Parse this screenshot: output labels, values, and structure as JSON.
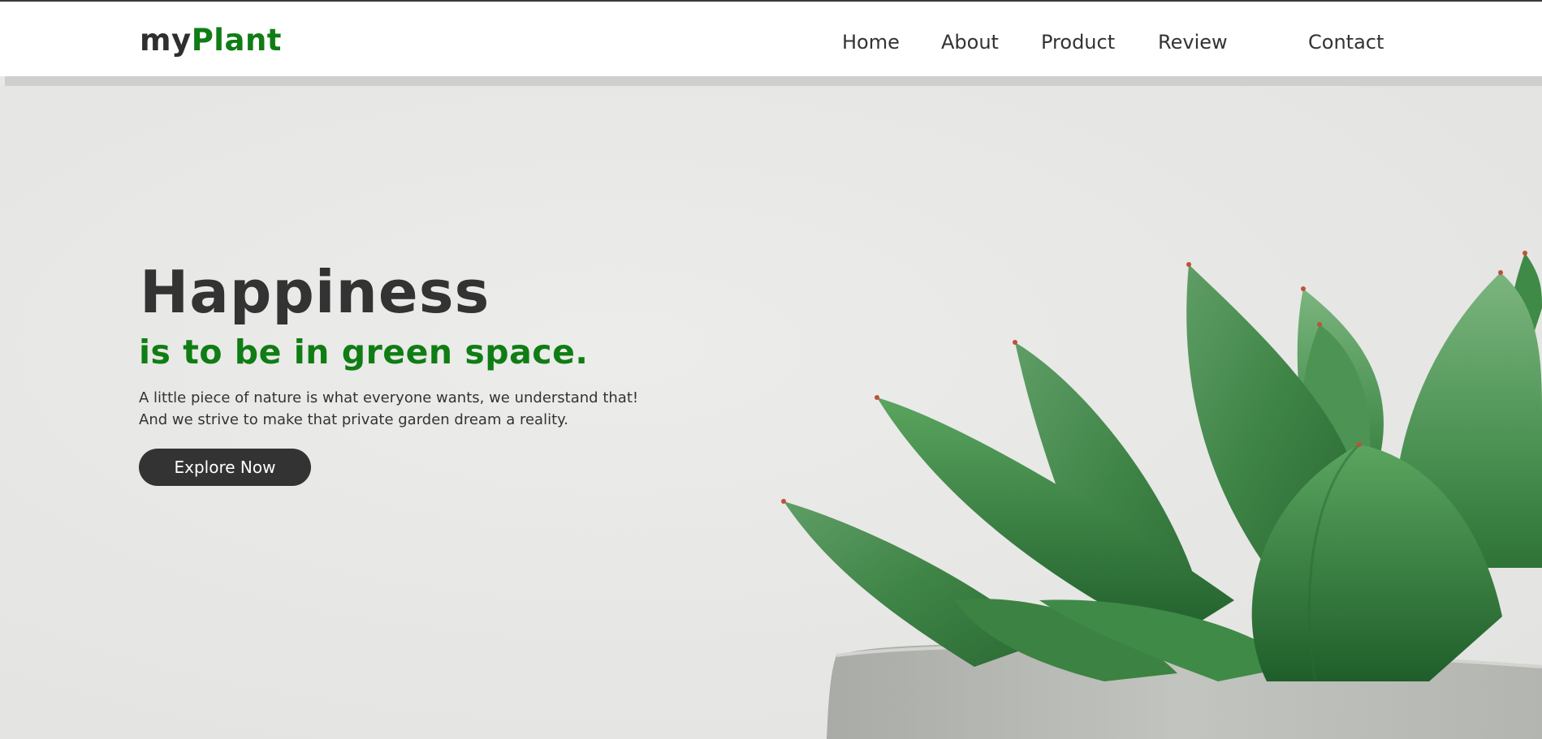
{
  "brand": {
    "prefix": "my",
    "highlight": "Plant"
  },
  "nav": {
    "items": [
      {
        "label": "Home"
      },
      {
        "label": "About"
      },
      {
        "label": "Product"
      },
      {
        "label": "Review"
      },
      {
        "label": "Contact"
      }
    ]
  },
  "hero": {
    "headline": "Happiness",
    "subheadline": "is to be in green space.",
    "description": "A little piece of nature is what everyone wants, we understand that! And we strive to make that private garden dream a reality.",
    "cta_label": "Explore Now",
    "image": "succulent-plant-in-concrete-pot"
  },
  "colors": {
    "accent": "#0f7d14",
    "text_dark": "#333333",
    "background": "#e8e8e6"
  }
}
